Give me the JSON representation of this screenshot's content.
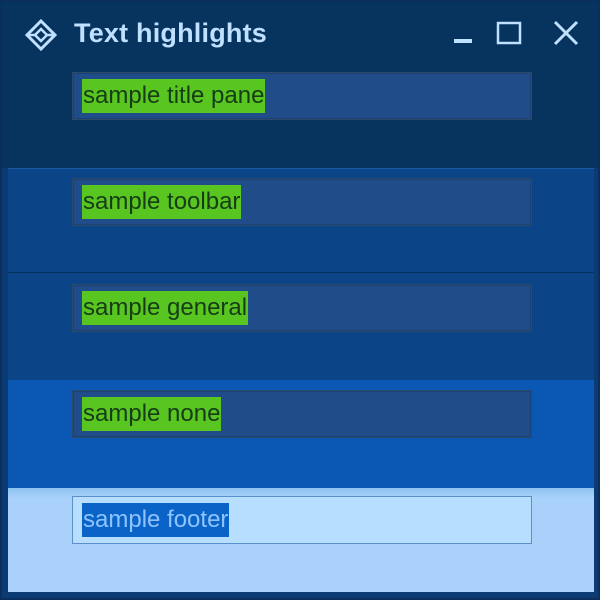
{
  "window": {
    "title": "Text highlights",
    "colors": {
      "title_pane": "#07335f",
      "toolbar_pane": "#0b4487",
      "general_pane": "#0b4487",
      "none_pane": "#0a57b4",
      "footer_pane": "#a9d1fa",
      "highlight_green": "#58c521",
      "highlight_blue": "#0a64c8",
      "title_text": "#bfe0ff"
    },
    "icons": {
      "app": "diamond-app-icon",
      "minimize": "minimize-icon",
      "maximize": "maximize-icon",
      "close": "close-icon"
    }
  },
  "fields": {
    "title_pane": "sample title pane",
    "toolbar": "sample toolbar",
    "general": "sample general",
    "none": "sample none",
    "footer": "sample footer"
  }
}
